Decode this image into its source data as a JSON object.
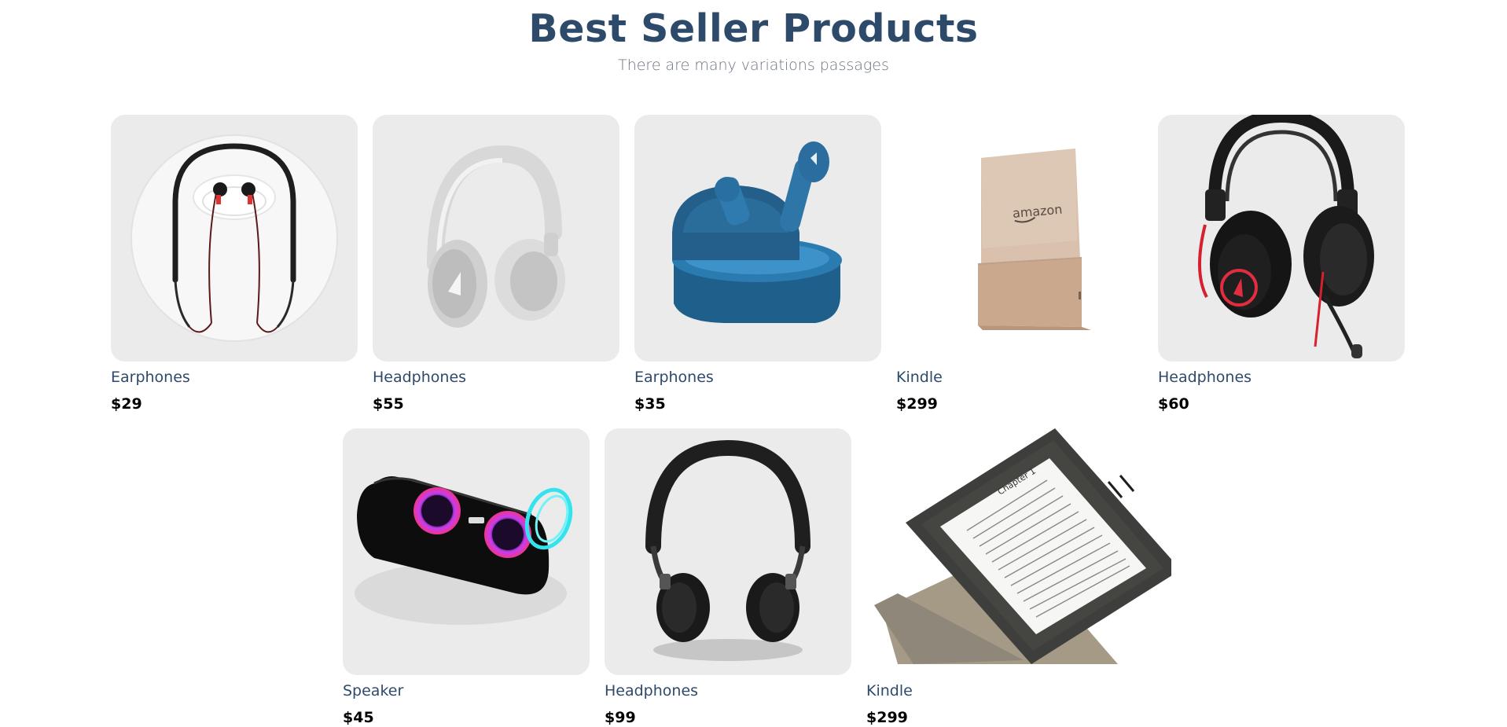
{
  "header": {
    "title": "Best Seller Products",
    "subtitle": "There are many variations passages"
  },
  "products": [
    {
      "name": "Earphones",
      "price": "$29",
      "image": "neckband-earphones"
    },
    {
      "name": "Headphones",
      "price": "$55",
      "image": "white-headphones"
    },
    {
      "name": "Earphones",
      "price": "$35",
      "image": "blue-earbuds-case"
    },
    {
      "name": "Kindle",
      "price": "$299",
      "image": "kindle-rose-gold",
      "image_text": "amazon"
    },
    {
      "name": "Headphones",
      "price": "$60",
      "image": "gaming-headset"
    },
    {
      "name": "Speaker",
      "price": "$45",
      "image": "bluetooth-speaker"
    },
    {
      "name": "Headphones",
      "price": "$99",
      "image": "black-headphones"
    },
    {
      "name": "Kindle",
      "price": "$299",
      "image": "kindle-oasis",
      "image_text": "Chapter 1"
    }
  ],
  "colors": {
    "title": "#2e4a6b",
    "card_background": "#ebebeb",
    "price": "#000000"
  }
}
